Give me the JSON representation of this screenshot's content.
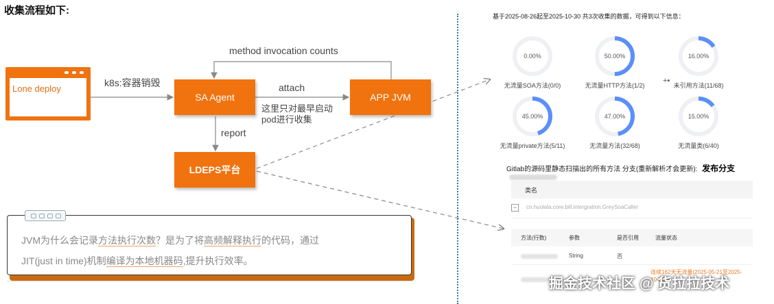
{
  "title": "收集流程如下:",
  "diagram": {
    "lone_deploy": "Lone deploy",
    "sa_agent": "SA Agent",
    "app_jvm": "APP JVM",
    "ldeps": "LDEPS平台",
    "edge_k8s": "k8s:容器销毁",
    "edge_method_counts": "method invocation counts",
    "edge_attach": "attach",
    "edge_report": "report",
    "attach_note_line1": "这里只对最早启动",
    "attach_note_line2": "pod进行收集",
    "colors": {
      "accent": "#f0730f",
      "arrow": "#888888",
      "dashed": "#8a8a8a"
    }
  },
  "note": {
    "line1": [
      {
        "t": "JVM为什么会记录",
        "u": false
      },
      {
        "t": "方法执行次数",
        "u": true
      },
      {
        "t": "？是为了将",
        "u": false
      },
      {
        "t": "高频解释执行",
        "u": true
      },
      {
        "t": "的代码，通过",
        "u": false
      }
    ],
    "line2": [
      {
        "t": "JIT(just in time)机制",
        "u": false
      },
      {
        "t": "编译为本地机器码",
        "u": true
      },
      {
        "t": ",提升执行效率。",
        "u": false
      }
    ]
  },
  "panel": {
    "header": "基于2025-08-26起至2025-10-30 共3次收集的数据，可得到以下信息：",
    "gauges": [
      {
        "percent": "0.00%",
        "value": 0.0,
        "label": "无流量SOA方法(0/0)"
      },
      {
        "percent": "50.00%",
        "value": 0.5,
        "label": "无流量HTTP方法(1/2)"
      },
      {
        "percent": "16.00%",
        "value": 0.16,
        "label": "未引用方法(11/68)"
      },
      {
        "percent": "45.00%",
        "value": 0.45,
        "label": "无流量private方法(5/11)"
      },
      {
        "percent": "47.00%",
        "value": 0.47,
        "label": "无流量方法(32/68)"
      },
      {
        "percent": "15.00%",
        "value": 0.15,
        "label": "无流量类(6/40)"
      }
    ],
    "section_title": "Gitlab的源码里静态扫描出的所有方法 分支(重新解析才会更新):",
    "branch": "发布分支",
    "table_header": "类名",
    "class_name": "cn.huolala.core.bill.intergration.GreySoaCaller",
    "expander": "−",
    "sub_headers": [
      "方法(行数)",
      "参数",
      "是否引用",
      "流量状态"
    ],
    "row": {
      "param": "String",
      "referenced": "否"
    },
    "traffic_line1": "连续162天无流量(2025-05-21至2025-",
    "traffic_line2": "10-30)",
    "colors": {
      "gauge": "#5b8ff9",
      "track": "#eef0f3"
    }
  },
  "watermark": "掘金技术社区 @ 货拉拉技术"
}
